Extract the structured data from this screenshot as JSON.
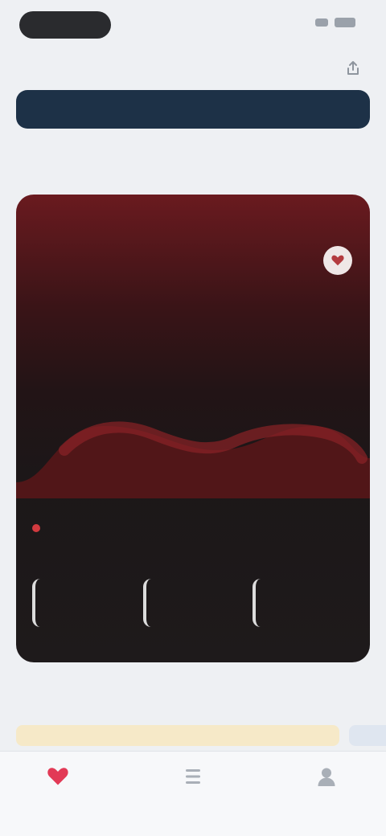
{
  "status_bar": {
    "pill_label": ""
  },
  "nav": {
    "title": "",
    "action_icon": "share-icon"
  },
  "banner": {
    "label": ""
  },
  "section": {
    "title": "",
    "link": ""
  },
  "card": {
    "title": "",
    "badge_icon": "heart-icon",
    "stats": [
      "",
      "",
      ""
    ],
    "legend_label": "",
    "legend_right": "",
    "metrics": [
      "",
      "",
      ""
    ],
    "accent_color": "#d23a3f"
  },
  "lower": {
    "title": "",
    "tip_text": ""
  },
  "tabs": [
    {
      "label": "",
      "icon": "heart-icon",
      "active": true
    },
    {
      "label": "",
      "icon": "list-icon",
      "active": false
    },
    {
      "label": "",
      "icon": "profile-icon",
      "active": false
    }
  ],
  "colors": {
    "banner_bg": "#1d3147",
    "active_tab": "#e23a56"
  }
}
